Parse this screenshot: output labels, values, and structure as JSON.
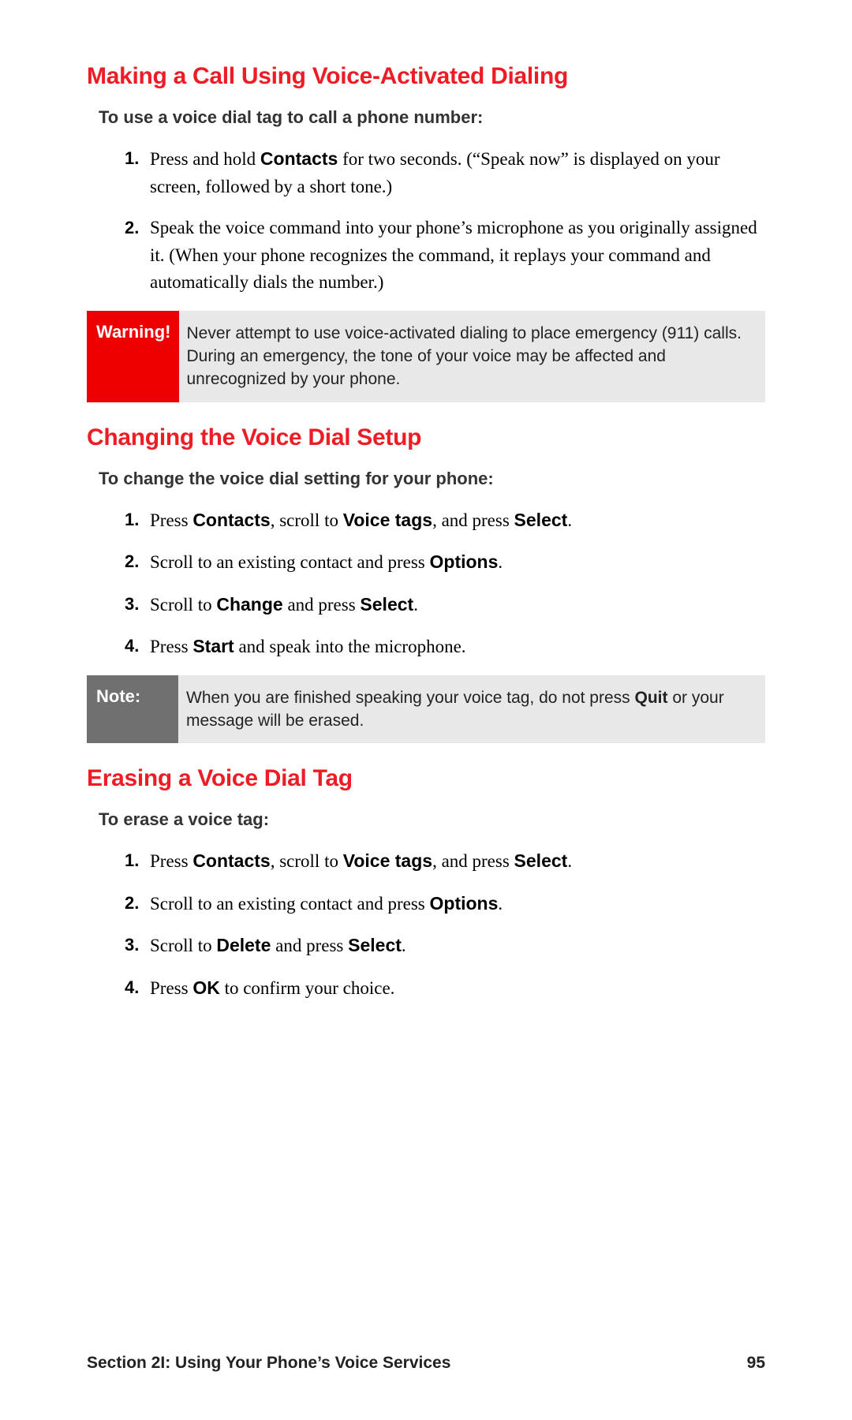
{
  "sections": [
    {
      "heading": "Making a Call Using Voice-Activated Dialing",
      "intro": "To use a voice dial tag to call a phone number:",
      "steps": [
        "Press and hold <b>Contacts</b> for two seconds. (“Speak now” is displayed on your screen, followed by a short tone.)",
        "Speak the voice command into your phone’s microphone as you originally assigned it. (When your phone recognizes the command, it replays your command and automatically dials the number.)"
      ],
      "callout": {
        "type": "warning",
        "label": "Warning!",
        "body": "Never attempt to use voice-activated dialing to place emergency (911) calls. During an emergency, the tone of your voice may be affected and unrecognized by your phone."
      }
    },
    {
      "heading": "Changing the Voice Dial Setup",
      "intro": "To change the voice dial setting for your phone:",
      "steps": [
        "Press <b>Contacts</b>, scroll to <b>Voice tags</b>, and press <b>Select</b>.",
        "Scroll to an existing contact and press <b>Options</b>.",
        "Scroll to <b>Change</b> and press <b>Select</b>.",
        "Press <b>Start</b> and speak into the microphone."
      ],
      "callout": {
        "type": "note",
        "label": "Note:",
        "body": "When you are finished speaking your voice tag, do not press <b>Quit</b> or your message will be erased."
      }
    },
    {
      "heading": "Erasing a Voice Dial Tag",
      "intro": "To erase a voice tag:",
      "steps": [
        "Press <b>Contacts</b>, scroll to <b>Voice tags</b>, and press <b>Select</b>.",
        "Scroll to an existing contact and press <b>Options</b>.",
        "Scroll to <b>Delete</b> and press <b>Select</b>.",
        "Press <b>OK</b> to confirm your choice."
      ]
    }
  ],
  "footer": {
    "section_label": "Section 2I: Using Your Phone’s Voice Services",
    "page_number": "95"
  }
}
